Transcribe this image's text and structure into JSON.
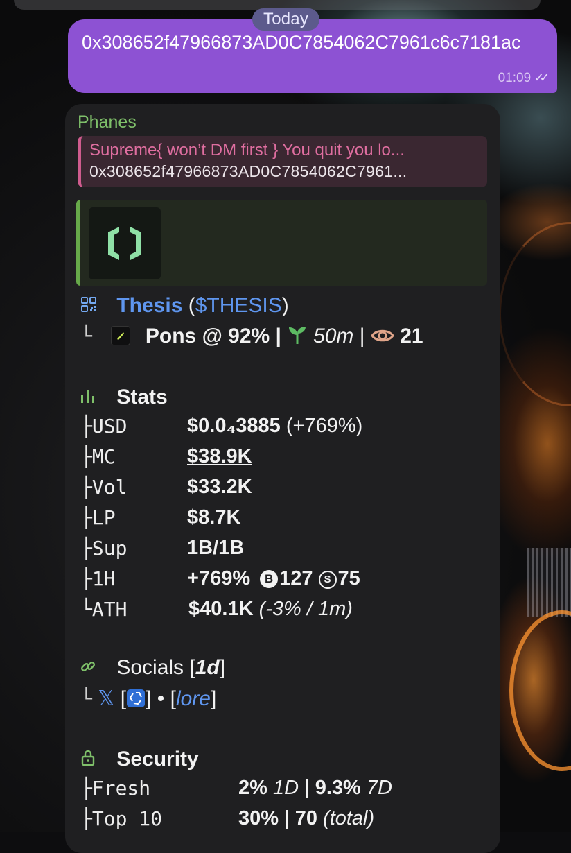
{
  "date_chip": "Today",
  "outgoing_message": {
    "text": "0x308652f47966873AD0C7854062C7961c6c7181ac",
    "time": "01:09"
  },
  "bot_message": {
    "sender": "Phanes",
    "reply": {
      "title": "Supreme{ won’t DM first } You quit you lo...",
      "text": "0x308652f47966873AD0C7854062C7961..."
    },
    "token": {
      "name": "Thesis",
      "ticker_open": "(",
      "ticker": "$THESIS",
      "ticker_close": ")",
      "platform": "Pons @ 92% |",
      "age": "50m",
      "age_sep": "|",
      "views": "21"
    },
    "stats": {
      "title": "Stats",
      "rows": [
        {
          "key": "USD",
          "value": "$0.0₄3885",
          "extra": "(+769%)"
        },
        {
          "key": "MC",
          "value": "$38.9K",
          "extra": ""
        },
        {
          "key": "Vol",
          "value": "$33.2K",
          "extra": ""
        },
        {
          "key": "LP",
          "value": "$8.7K",
          "extra": ""
        },
        {
          "key": "Sup",
          "value": "1B/1B",
          "extra": ""
        },
        {
          "key": "1H",
          "value": "+769%",
          "buys": "127",
          "sells": "75"
        },
        {
          "key": "ATH",
          "value": "$40.1K",
          "extra": "(-3% / 1m)"
        }
      ]
    },
    "socials": {
      "title": "Socials",
      "age": "1d",
      "x": "𝕏",
      "dot": "•",
      "lore": "lore"
    },
    "security": {
      "title": "Security",
      "rows": [
        {
          "key": "Fresh",
          "v1": "2%",
          "p1": "1D",
          "v2": "9.3%",
          "p2": "7D"
        },
        {
          "key": "Top 10",
          "v1": "30%",
          "v2": "70",
          "p2": "(total)"
        }
      ]
    }
  },
  "colors": {
    "outgoing_bubble": "#8d52d3",
    "incoming_bubble": "#1f1f21",
    "sender": "#7fc06a",
    "link": "#5f96ef",
    "reply_accent": "#cf5c8e",
    "preview_accent": "#67a94a"
  }
}
